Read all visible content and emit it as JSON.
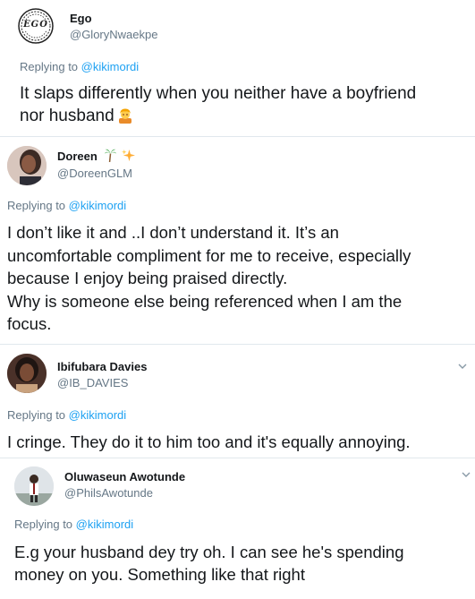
{
  "tweets": [
    {
      "name": "Ego",
      "handle": "@GloryNwaekpe",
      "avatar_text": "EGO",
      "reply_prefix": "Replying to",
      "reply_to": "@kikimordi",
      "lines": [
        "It slaps differently when you neither have a boyfriend",
        "nor husband"
      ]
    },
    {
      "name": "Doreen",
      "handle": "@DoreenGLM",
      "reply_prefix": "Replying to",
      "reply_to": "@kikimordi",
      "lines": [
        "I don’t like it and ..I don’t understand it. It’s an",
        "uncomfortable compliment for me to receive, especially",
        "because I enjoy being praised directly.",
        "Why is someone else being referenced when I am the",
        "focus."
      ]
    },
    {
      "name": "Ibifubara Davies",
      "handle": "@IB_DAVIES",
      "reply_prefix": "Replying to",
      "reply_to": "@kikimordi",
      "lines": [
        "I cringe. They do it to him too and it's equally annoying."
      ]
    },
    {
      "name": "Oluwaseun Awotunde",
      "handle": "@PhilsAwotunde",
      "reply_prefix": "Replying to",
      "reply_to": "@kikimordi",
      "lines": [
        "E.g your husband dey try oh. I can see he's spending",
        "money on you. Something like that right"
      ]
    }
  ],
  "icons": {
    "emoji": "person-with-blond-hair-emoji",
    "palm": "palm-tree-emoji",
    "sparkles": "sparkles-emoji",
    "caret": "chevron-down-icon"
  },
  "colors": {
    "link": "#1da1f2",
    "muted": "#657786",
    "text": "#14171a"
  }
}
